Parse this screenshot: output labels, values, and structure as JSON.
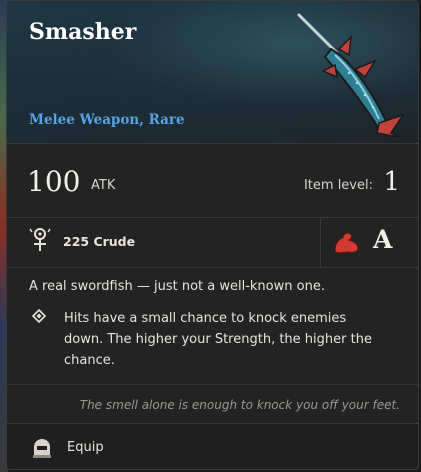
{
  "item": {
    "name": "Smasher",
    "type_rarity": "Melee Weapon, Rare",
    "image_icon": "swordfish-weapon-icon"
  },
  "stats": {
    "atk_value": "100",
    "atk_unit": "ATK",
    "item_level_label": "Item level:",
    "item_level_value": "1"
  },
  "requirement": {
    "icon": "crude-material-icon",
    "text": "225 Crude",
    "scaling_icon": "strength-arm-icon",
    "scaling_grade": "A"
  },
  "description": "A real swordfish — just not a well-known one.",
  "ability": {
    "icon": "diamond-bullet-icon",
    "text": "Hits have a small chance to knock enemies down. The higher your Strength, the higher the chance."
  },
  "lore": "The smell alone is enough to knock you off your feet.",
  "footer": {
    "icon": "equip-helmet-icon",
    "label": "Equip"
  },
  "colors": {
    "rarity": "#5aa2e6",
    "card_bg": "#232323",
    "strength_red": "#d23a32"
  }
}
